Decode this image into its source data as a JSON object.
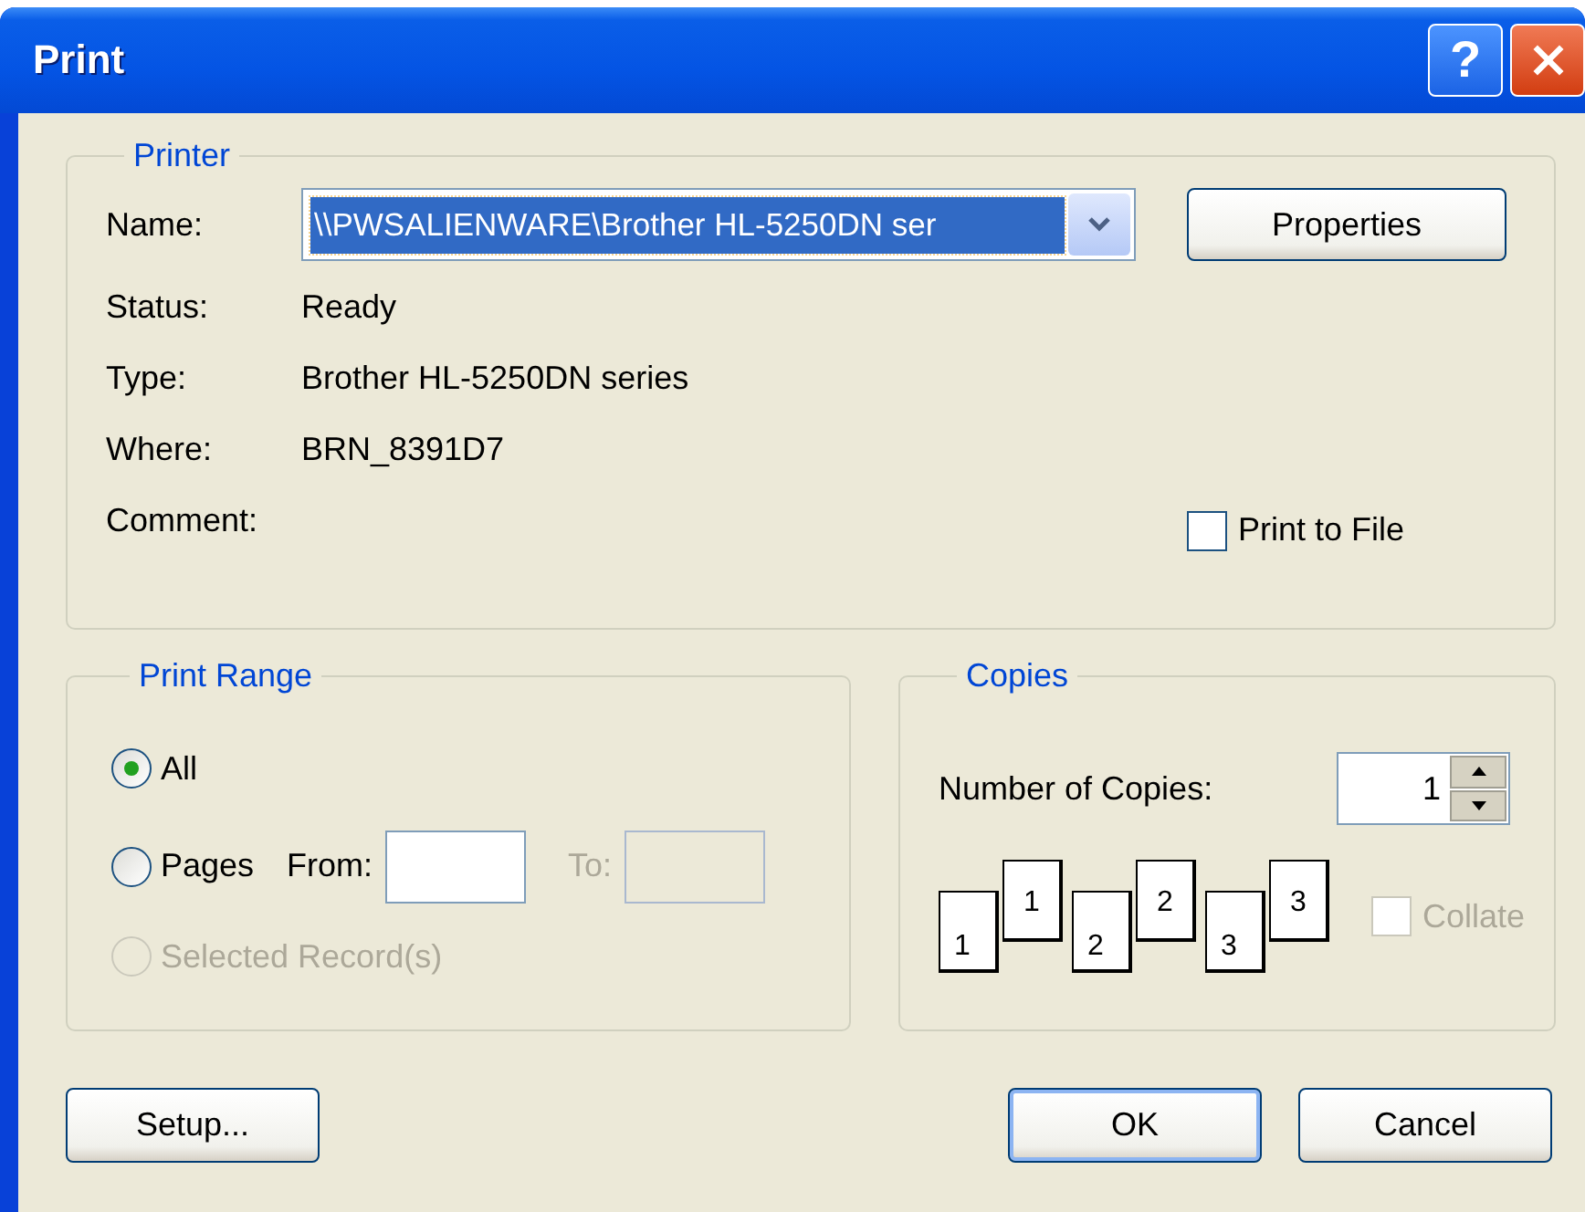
{
  "window": {
    "title": "Print",
    "help_button": "?"
  },
  "printer": {
    "legend": "Printer",
    "name_label": "Name:",
    "name_value": "\\\\PWSALIENWARE\\Brother HL-5250DN ser",
    "properties_button": "Properties",
    "info": [
      {
        "label": "Status:",
        "value": "Ready"
      },
      {
        "label": "Type:",
        "value": "Brother HL-5250DN series"
      },
      {
        "label": "Where:",
        "value": "BRN_8391D7"
      },
      {
        "label": "Comment:"
      }
    ],
    "print_to_file": {
      "label": "Print to File",
      "checked": false
    }
  },
  "print_range": {
    "legend": "Print Range",
    "options": [
      {
        "kind": "plain",
        "label": "All",
        "selected": true,
        "disabled": false
      },
      {
        "kind": "pages",
        "label": "Pages",
        "selected": false,
        "disabled": false,
        "from": {
          "label": "From:",
          "disabled": false
        },
        "to": {
          "label": "To:",
          "disabled": true
        }
      },
      {
        "kind": "plain",
        "label": "Selected Record(s)",
        "selected": false,
        "disabled": true
      }
    ]
  },
  "copies": {
    "legend": "Copies",
    "label": "Number of Copies:",
    "value": "1",
    "collate_pictures": [
      {
        "back": "1",
        "front": "1"
      },
      {
        "back": "2",
        "front": "2"
      },
      {
        "back": "3",
        "front": "3"
      }
    ],
    "collate": {
      "label": "Collate",
      "checked": false,
      "disabled": true
    }
  },
  "buttons": [
    {
      "label": "Setup...",
      "default": false
    },
    {
      "label": "OK",
      "default": true
    },
    {
      "label": "Cancel",
      "default": false
    }
  ]
}
